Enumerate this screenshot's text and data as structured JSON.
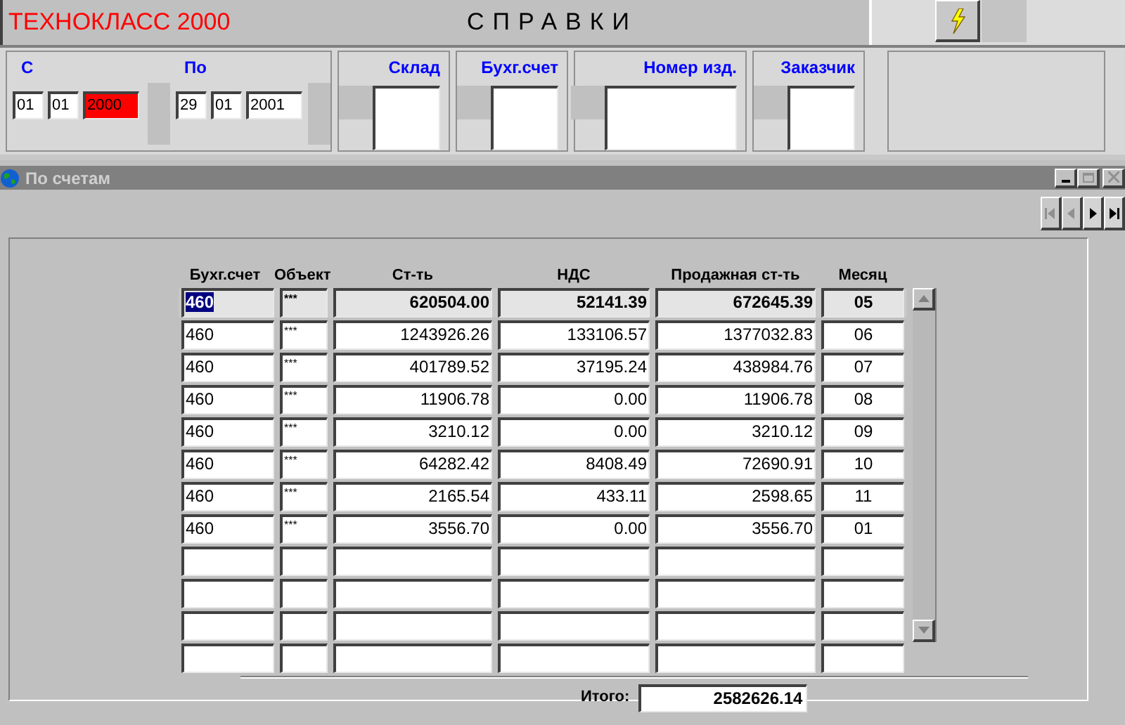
{
  "app": {
    "brand": "ТЕХНОКЛАСС 2000",
    "title": "СПРАВКИ"
  },
  "filters": {
    "from": {
      "label": "С",
      "parts": [
        {
          "value": "01",
          "highlighted": false
        },
        {
          "value": "01",
          "highlighted": false
        },
        {
          "value": "2000",
          "highlighted": true
        }
      ]
    },
    "to": {
      "label": "По",
      "parts": [
        {
          "value": "29",
          "highlighted": false
        },
        {
          "value": "01",
          "highlighted": false
        },
        {
          "value": "2001",
          "highlighted": false
        }
      ]
    },
    "fields": [
      {
        "label": "Склад",
        "kind": "narrow"
      },
      {
        "label": "Бухг.счет",
        "kind": "narrow"
      },
      {
        "label": "Номер изд.",
        "kind": "wide"
      },
      {
        "label": "Заказчик",
        "kind": "narrow"
      }
    ]
  },
  "window": {
    "title": "По счетам",
    "nav": [
      {
        "kind": "first",
        "disabled": true
      },
      {
        "kind": "prev",
        "disabled": true
      },
      {
        "kind": "next",
        "disabled": false
      },
      {
        "kind": "last",
        "disabled": false
      }
    ]
  },
  "table": {
    "columns": [
      "Бухг.счет",
      "Объект",
      "Ст-ть",
      "НДС",
      "Продажная ст-ть",
      "Месяц"
    ],
    "rows": [
      {
        "cells": [
          "460",
          "***",
          "620504.00",
          "52141.39",
          "672645.39",
          "05"
        ],
        "selected": true
      },
      {
        "cells": [
          "460",
          "***",
          "1243926.26",
          "133106.57",
          "1377032.83",
          "06"
        ],
        "selected": false
      },
      {
        "cells": [
          "460",
          "***",
          "401789.52",
          "37195.24",
          "438984.76",
          "07"
        ],
        "selected": false
      },
      {
        "cells": [
          "460",
          "***",
          "11906.78",
          "0.00",
          "11906.78",
          "08"
        ],
        "selected": false
      },
      {
        "cells": [
          "460",
          "***",
          "3210.12",
          "0.00",
          "3210.12",
          "09"
        ],
        "selected": false
      },
      {
        "cells": [
          "460",
          "***",
          "64282.42",
          "8408.49",
          "72690.91",
          "10"
        ],
        "selected": false
      },
      {
        "cells": [
          "460",
          "***",
          "2165.54",
          "433.11",
          "2598.65",
          "11"
        ],
        "selected": false
      },
      {
        "cells": [
          "460",
          "***",
          "3556.70",
          "0.00",
          "3556.70",
          "01"
        ],
        "selected": false
      }
    ]
  },
  "total": {
    "label": "Итого:",
    "value": "2582626.14"
  }
}
